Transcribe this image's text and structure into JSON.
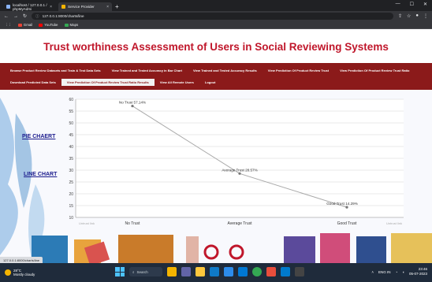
{
  "browser": {
    "tabs": [
      {
        "label": "localhost / 127.0.0.1 / phpMyAdmi"
      },
      {
        "label": "Service Provider"
      }
    ],
    "address": "127.0.0.1:8000/charts/line",
    "bookmarks": [
      {
        "label": "Gmail",
        "color": "#ea4335"
      },
      {
        "label": "YouTube",
        "color": "#ff0000"
      },
      {
        "label": "Maps",
        "color": "#34a853"
      }
    ]
  },
  "page": {
    "title": "Trust worthiness Assessment of Users in Social Reviewing Systems",
    "nav": [
      {
        "label": "Browse Product Review Datasets and Train & Test Data Sets",
        "active": false
      },
      {
        "label": "View Trained and Tested Accuracy in Bar Chart",
        "active": false
      },
      {
        "label": "View Trained and Tested Accuracy Results",
        "active": false
      },
      {
        "label": "View Prediction Of Product Review Trust",
        "active": false
      },
      {
        "label": "View Prediction Of Product Review Trust Ratio",
        "active": false
      },
      {
        "label": "Download Predicted Data Sets",
        "active": false
      },
      {
        "label": "View Prediction Of Product Review Trust Ratio Results",
        "active": true
      },
      {
        "label": "View All Remote Users",
        "active": false
      },
      {
        "label": "Logout",
        "active": false
      }
    ],
    "side_links": {
      "pie": "PIE CHAERT",
      "line": "LINE CHART"
    },
    "accent_color": "#8b1a1a",
    "title_color": "#c0172b"
  },
  "chart_data": {
    "type": "line",
    "categories": [
      "No Trust",
      "Average Trust",
      "Good Trust"
    ],
    "values": [
      57.14,
      28.57,
      14.29
    ],
    "data_labels": [
      "No Trust 57.14%",
      "Average Trust 28.57%",
      "Good Trust 14.29%"
    ],
    "yticks": [
      "10",
      "15",
      "20",
      "25",
      "30",
      "35",
      "40",
      "45",
      "50",
      "55",
      "60"
    ],
    "ylim": [
      10,
      60
    ],
    "grid": true,
    "legend_left": "Untrust link",
    "legend_right": "Untrust link",
    "line_color": "#a9a9a9"
  },
  "status": {
    "url": "127.0.0.1:8000/charts/line"
  },
  "taskbar": {
    "weather_temp": "28°C",
    "weather_text": "Mostly cloudy",
    "search_label": "Search",
    "time": "23:46",
    "date": "05-07-2023",
    "lang": "ENG IN"
  }
}
